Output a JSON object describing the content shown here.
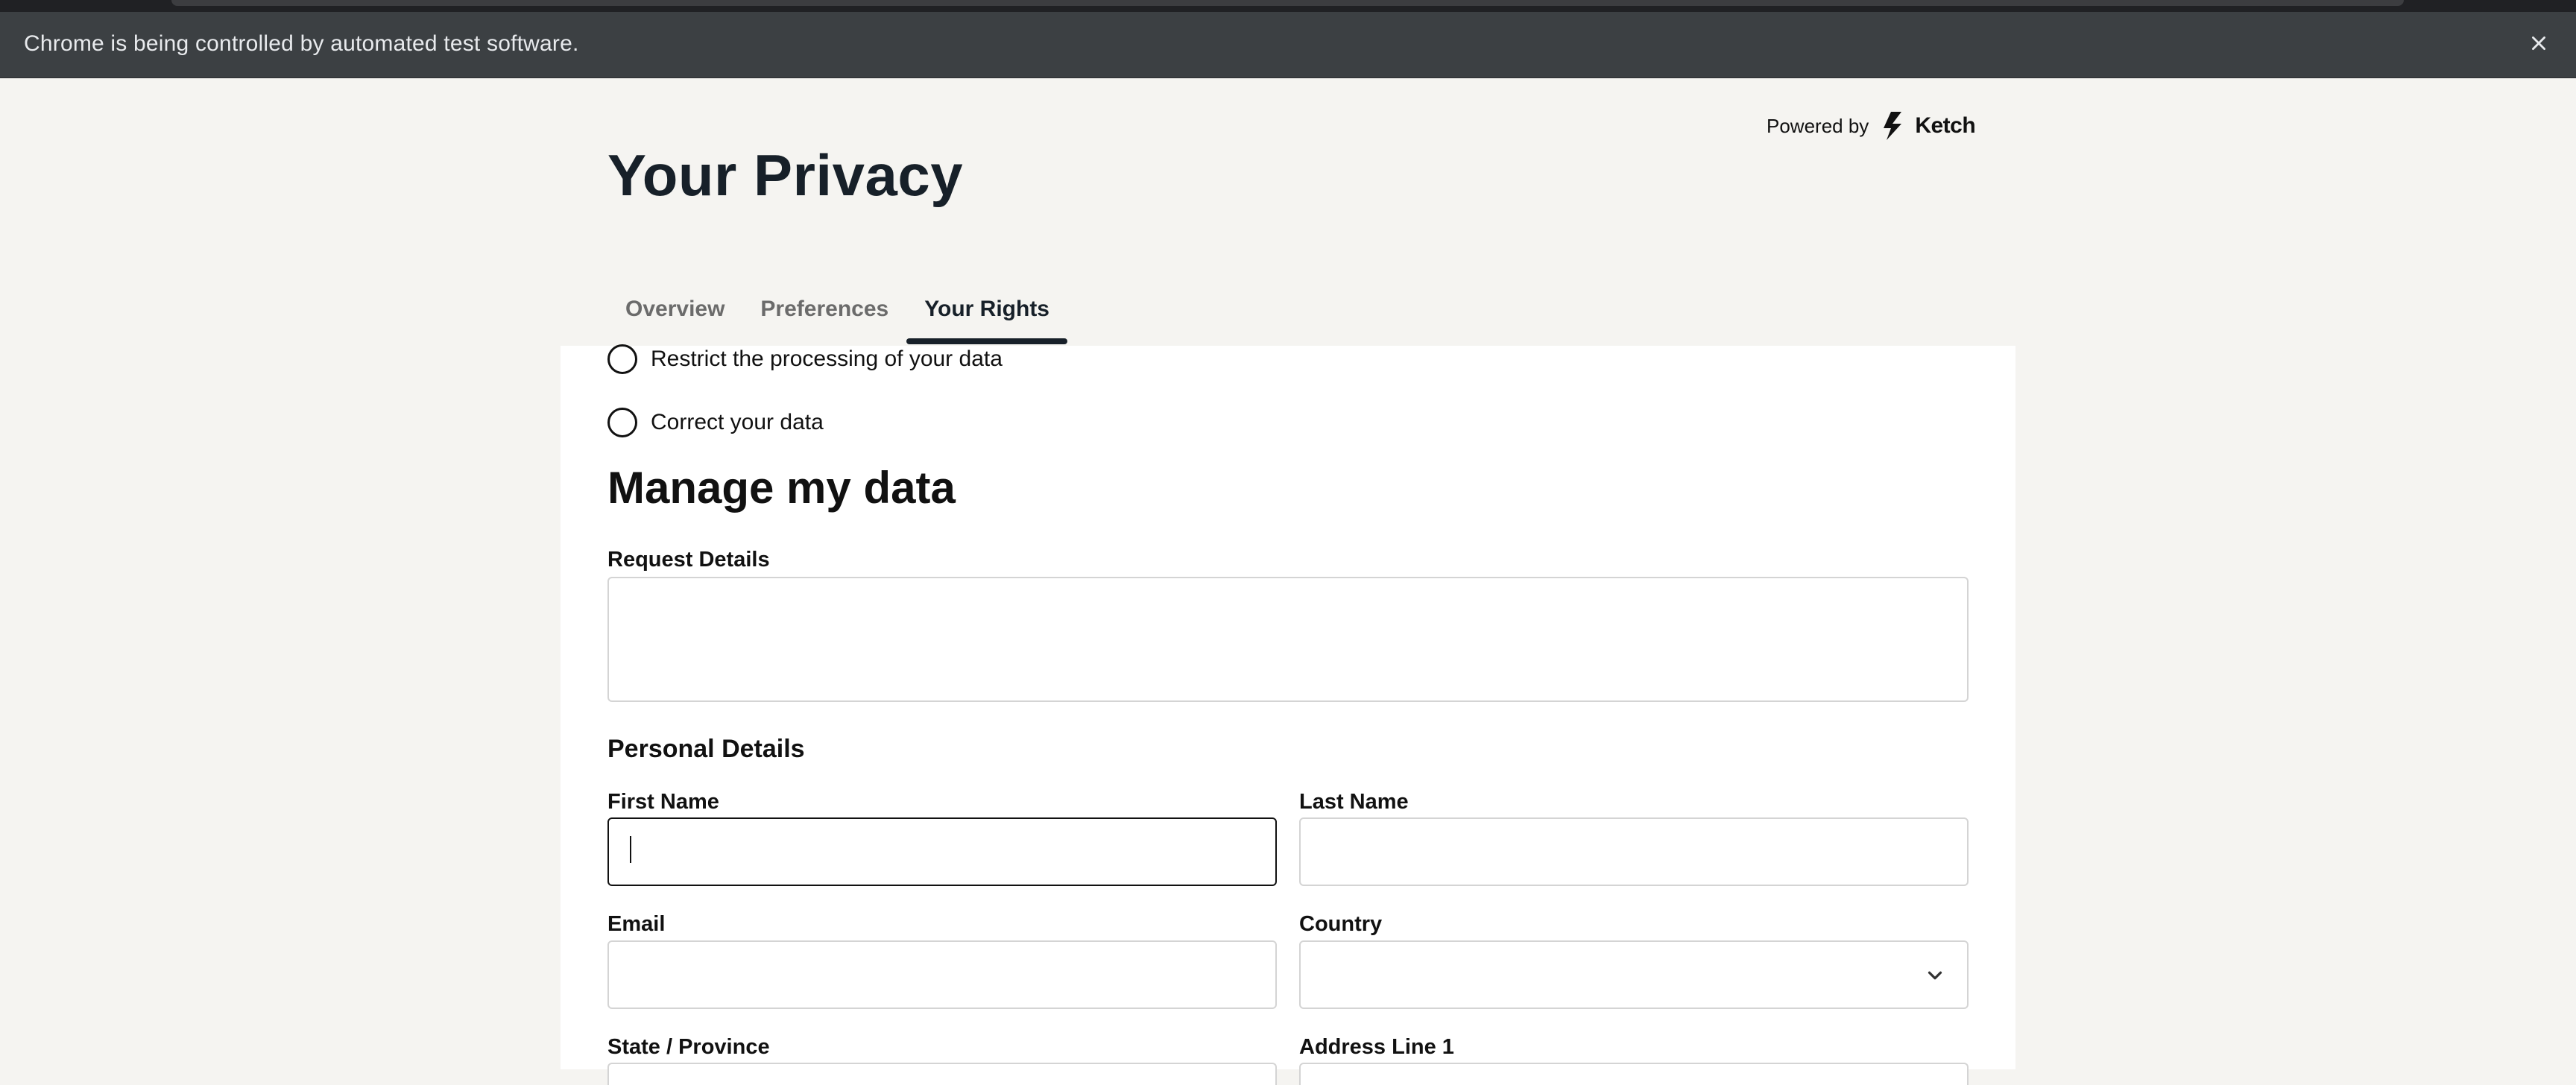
{
  "browser": {
    "infobar_text": "Chrome is being controlled by automated test software.",
    "close_icon": "close-icon"
  },
  "brand": {
    "powered_by": "Powered by",
    "logo_name": "Ketch"
  },
  "page": {
    "title": "Your Privacy"
  },
  "tabs": [
    {
      "label": "Overview",
      "active": false
    },
    {
      "label": "Preferences",
      "active": false
    },
    {
      "label": "Your Rights",
      "active": true
    }
  ],
  "rights_options": [
    {
      "label": "Restrict the processing of your data",
      "selected": false
    },
    {
      "label": "Correct your data",
      "selected": false
    }
  ],
  "form": {
    "section_title": "Manage my data",
    "request_details_label": "Request Details",
    "request_details_value": "",
    "personal_details_heading": "Personal Details",
    "first_name_label": "First Name",
    "first_name_value": "",
    "last_name_label": "Last Name",
    "last_name_value": "",
    "email_label": "Email",
    "email_value": "",
    "country_label": "Country",
    "country_value": "",
    "state_label": "State / Province",
    "address_line1_label": "Address Line 1"
  },
  "colors": {
    "page_bg": "#f5f4f1",
    "panel_bg": "#ffffff",
    "title_color": "#172029",
    "infobar_bg": "#3c4043"
  }
}
